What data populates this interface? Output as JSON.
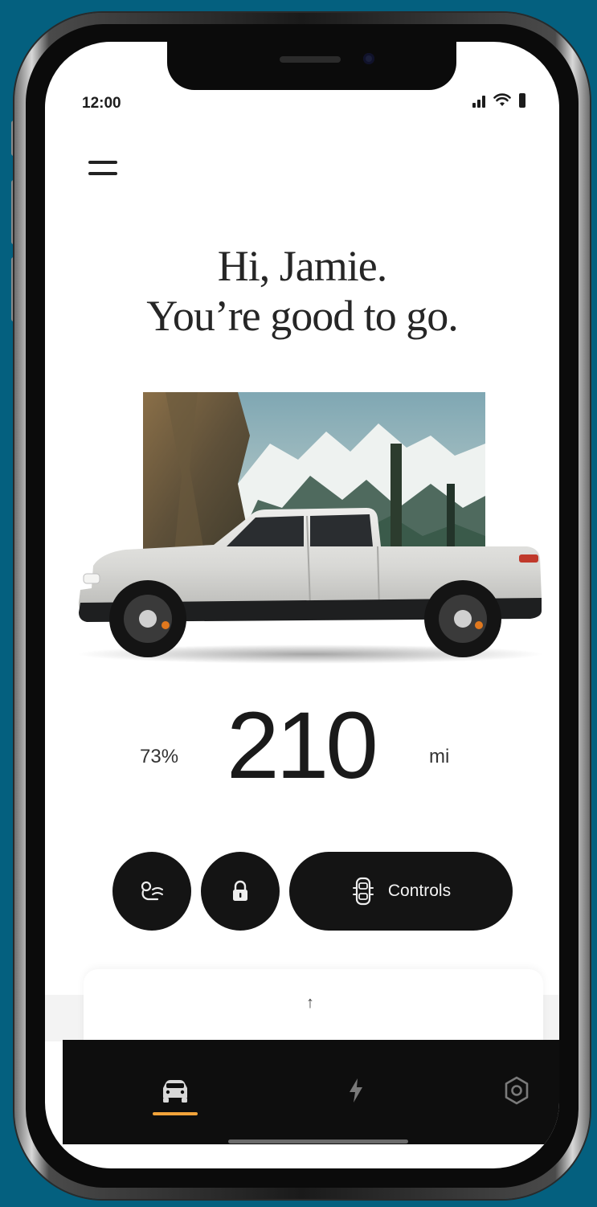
{
  "status": {
    "time": "12:00"
  },
  "greeting": {
    "line1": "Hi, Jamie.",
    "line2": "You’re good to go."
  },
  "range": {
    "percent": "73%",
    "value": "210",
    "unit": "mi"
  },
  "actions": {
    "controls_label": "Controls"
  },
  "drawer": {
    "arrow": "↑"
  },
  "tabs": {
    "active": "vehicle"
  },
  "colors": {
    "background": "#04607f",
    "accent": "#f1a33a",
    "button": "#141414",
    "tabbar": "#0e0e0e"
  },
  "icons": [
    "menu-icon",
    "signal-icon",
    "wifi-icon",
    "battery-icon",
    "climate-icon",
    "lock-icon",
    "vehicle-controls-icon",
    "car-icon",
    "charge-icon",
    "settings-icon"
  ]
}
